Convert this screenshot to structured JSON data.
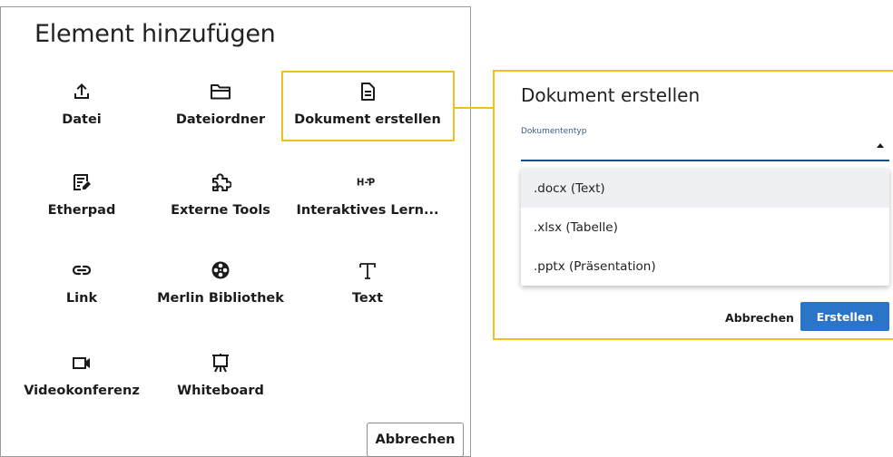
{
  "left_dialog": {
    "title": "Element hinzufügen",
    "items": [
      {
        "label": "Datei",
        "icon": "upload-icon"
      },
      {
        "label": "Dateiordner",
        "icon": "folder-icon"
      },
      {
        "label": "Dokument erstellen",
        "icon": "document-icon"
      },
      {
        "label": "Etherpad",
        "icon": "edit-note-icon"
      },
      {
        "label": "Externe Tools",
        "icon": "puzzle-icon"
      },
      {
        "label": "Interaktives Lern...",
        "icon": "h5p-icon"
      },
      {
        "label": "Link",
        "icon": "link-icon"
      },
      {
        "label": "Merlin Bibliothek",
        "icon": "film-reel-icon"
      },
      {
        "label": "Text",
        "icon": "text-icon"
      },
      {
        "label": "Videokonferenz",
        "icon": "video-camera-icon"
      },
      {
        "label": "Whiteboard",
        "icon": "easel-icon"
      }
    ],
    "cancel_label": "Abbrechen"
  },
  "right_dialog": {
    "title": "Dokument erstellen",
    "field_label": "Dokumententyp",
    "options": [
      ".docx (Text)",
      ".xlsx (Tabelle)",
      ".pptx (Präsentation)"
    ],
    "cancel_label": "Abbrechen",
    "create_label": "Erstellen"
  },
  "colors": {
    "highlight": "#f2c01e",
    "primary": "#2a75c7",
    "select_line": "#1d4e89"
  }
}
